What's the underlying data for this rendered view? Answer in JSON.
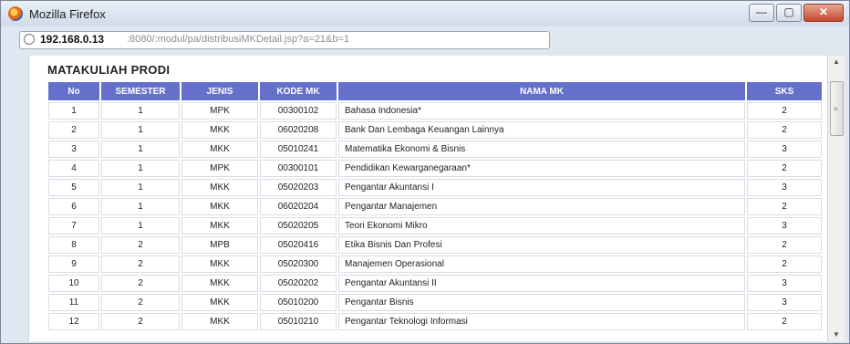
{
  "window": {
    "title": "Mozilla Firefox",
    "buttons": {
      "minimize": "—",
      "maximize": "▢",
      "close": "✕"
    }
  },
  "address_bar": {
    "host": "192.168.0.13",
    "path": ":8080/:modul/pa/distribusiMKDetail.jsp?a=21&b=1"
  },
  "page": {
    "heading": "MATAKULIAH PRODI",
    "columns": [
      "No",
      "SEMESTER",
      "JENIS",
      "KODE MK",
      "NAMA MK",
      "SKS"
    ],
    "rows": [
      [
        "1",
        "1",
        "MPK",
        "00300102",
        "Bahasa Indonesia*",
        "2"
      ],
      [
        "2",
        "1",
        "MKK",
        "06020208",
        "Bank Dan Lembaga Keuangan Lainnya",
        "2"
      ],
      [
        "3",
        "1",
        "MKK",
        "05010241",
        "Matematika Ekonomi & Bisnis",
        "3"
      ],
      [
        "4",
        "1",
        "MPK",
        "00300101",
        "Pendidikan Kewarganegaraan*",
        "2"
      ],
      [
        "5",
        "1",
        "MKK",
        "05020203",
        "Pengantar Akuntansi I",
        "3"
      ],
      [
        "6",
        "1",
        "MKK",
        "06020204",
        "Pengantar Manajemen",
        "2"
      ],
      [
        "7",
        "1",
        "MKK",
        "05020205",
        "Teori Ekonomi Mikro",
        "3"
      ],
      [
        "8",
        "2",
        "MPB",
        "05020416",
        "Etika Bisnis Dan Profesi",
        "2"
      ],
      [
        "9",
        "2",
        "MKK",
        "05020300",
        "Manajemen Operasional",
        "2"
      ],
      [
        "10",
        "2",
        "MKK",
        "05020202",
        "Pengantar Akuntansi II",
        "3"
      ],
      [
        "11",
        "2",
        "MKK",
        "05010200",
        "Pengantar Bisnis",
        "3"
      ],
      [
        "12",
        "2",
        "MKK",
        "05010210",
        "Pengantar Teknologi Informasi",
        "2"
      ]
    ]
  },
  "icons": {
    "app": "firefox-icon",
    "site": "globe-icon"
  },
  "colors": {
    "table_header": "#6470cc",
    "titlebar": "#dfe7f1"
  }
}
